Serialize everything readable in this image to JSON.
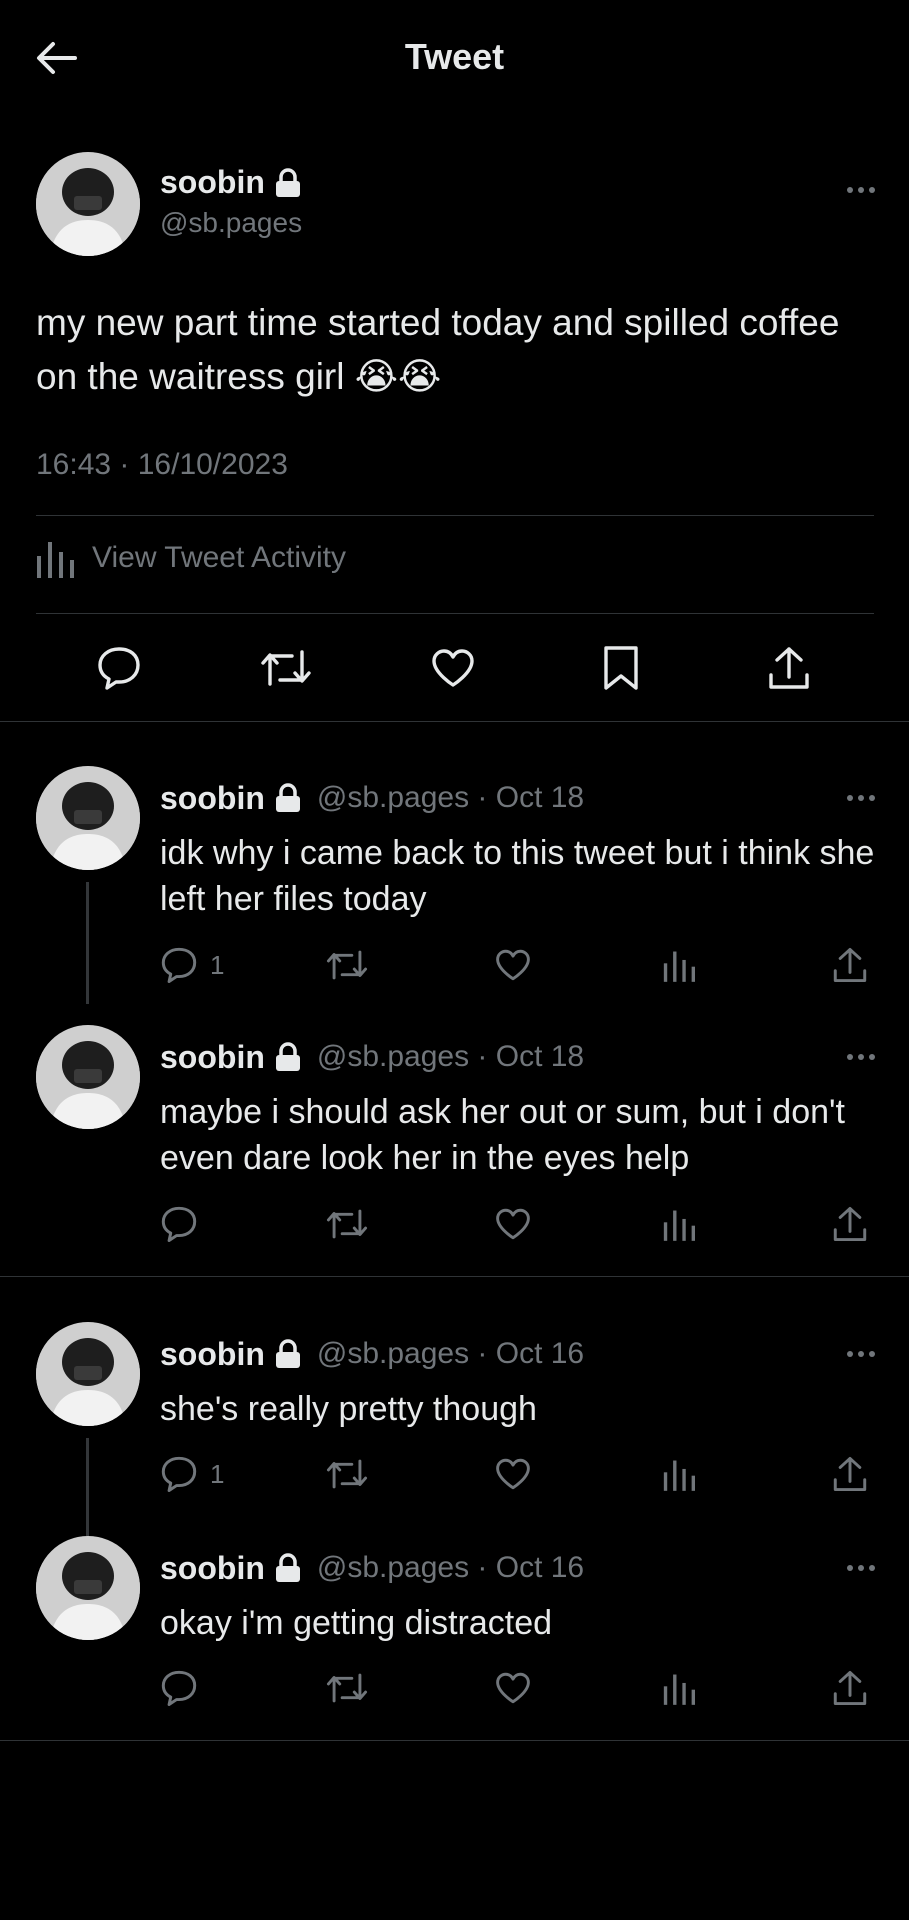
{
  "header": {
    "title": "Tweet",
    "back_icon": "arrow-left-icon"
  },
  "main_tweet": {
    "name": "soobin",
    "handle": "@sb.pages",
    "text": "my new part time started today and spilled coffee on the waitress girl",
    "emojis": [
      "😭",
      "😭"
    ],
    "timestamp": "16:43 · 16/10/2023",
    "activity_label": "View Tweet Activity"
  },
  "replies": [
    {
      "name": "soobin",
      "meta": "@sb.pages · Oct 18",
      "text": "idk why i came back to this tweet but i think she left her files today",
      "reply_count": "1"
    },
    {
      "name": "soobin",
      "meta": "@sb.pages · Oct 18",
      "text": "maybe i should ask her out or sum, but i don't even dare look her in the eyes help",
      "reply_count": ""
    },
    {
      "name": "soobin",
      "meta": "@sb.pages · Oct 16",
      "text": "she's really pretty though",
      "reply_count": "1"
    },
    {
      "name": "soobin",
      "meta": "@sb.pages · Oct 16",
      "text": "okay i'm getting distracted",
      "reply_count": ""
    }
  ],
  "colors": {
    "background": "#000000",
    "text": "#e7e9ea",
    "secondary": "#71767b",
    "divider": "#2f3336"
  }
}
